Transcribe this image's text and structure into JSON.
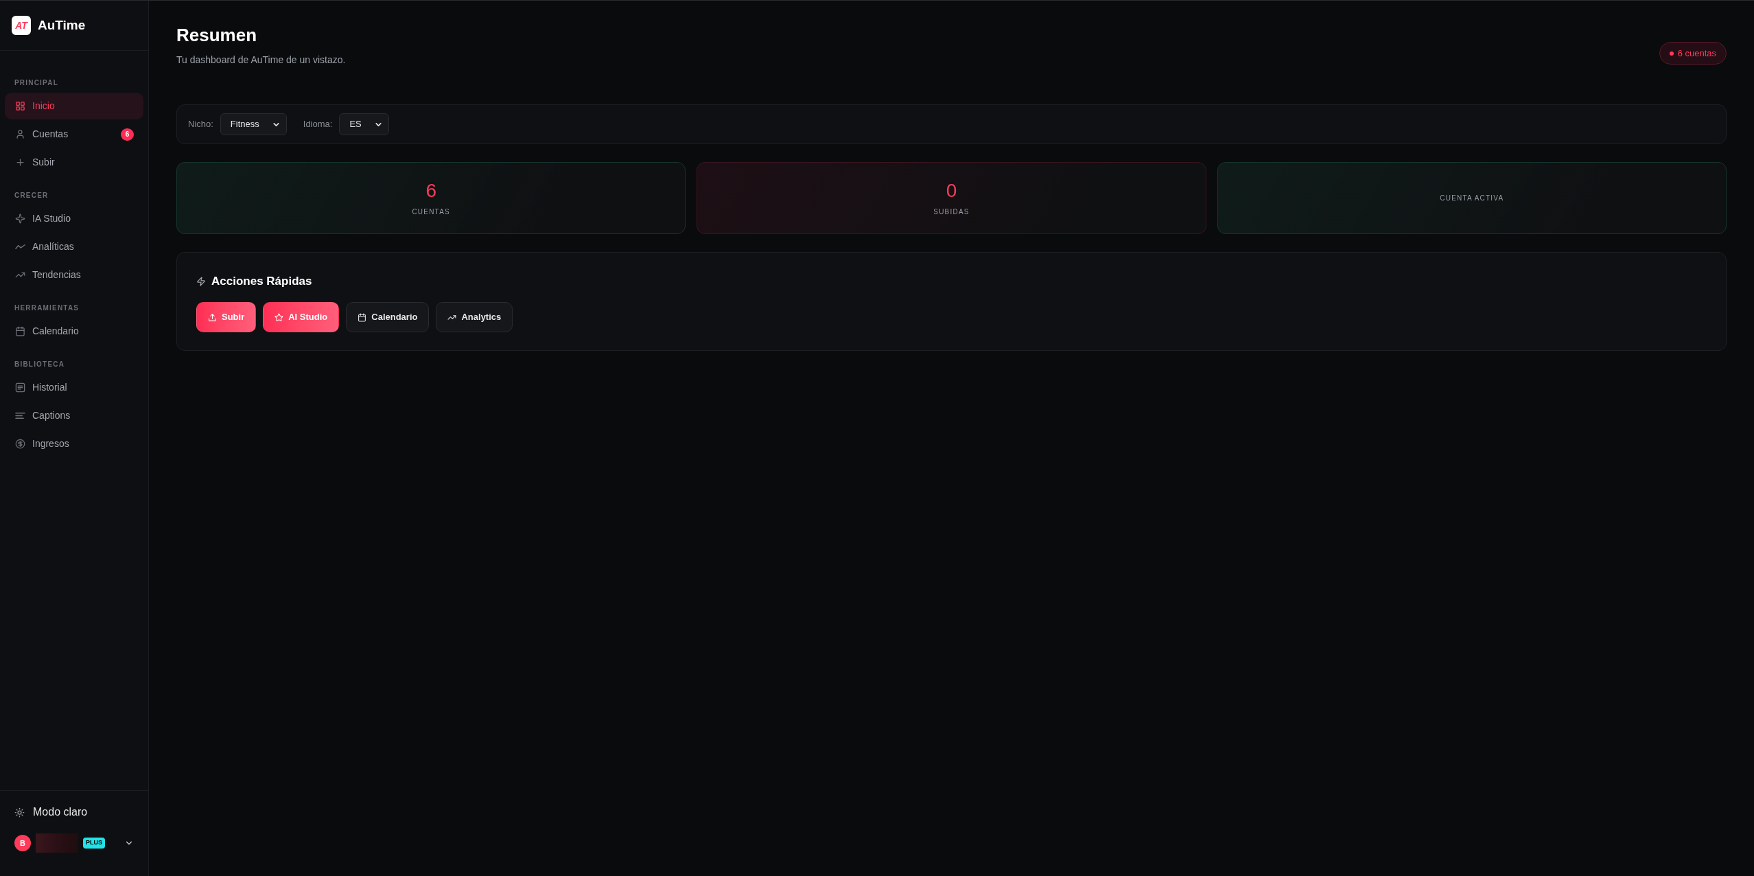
{
  "sidebar": {
    "logo": {
      "mark": "AT",
      "name": "AuTime"
    },
    "sections": [
      {
        "label": "PRINCIPAL",
        "items": [
          {
            "label": "Inicio",
            "selected": true
          },
          {
            "label": "Cuentas",
            "selected": false,
            "badge": "6"
          },
          {
            "label": "Subir",
            "selected": false
          }
        ]
      },
      {
        "label": "CRECER",
        "items": [
          {
            "label": "IA Studio",
            "selected": false
          },
          {
            "label": "Analíticas",
            "selected": false
          },
          {
            "label": "Tendencias",
            "selected": false
          }
        ]
      },
      {
        "label": "HERRAMIENTAS",
        "items": [
          {
            "label": "Calendario",
            "selected": false
          }
        ]
      },
      {
        "label": "BIBLIOTECA",
        "items": [
          {
            "label": "Historial",
            "selected": false
          },
          {
            "label": "Captions",
            "selected": false
          },
          {
            "label": "Ingresos",
            "selected": false
          }
        ]
      }
    ],
    "theme_toggle": {
      "label": "Modo claro"
    },
    "user": {
      "initial": "B",
      "plan": "PLUS"
    }
  },
  "header": {
    "title": "Resumen",
    "subtitle": "Tu dashboard de AuTime de un vistazo.",
    "badge": "6 cuentas"
  },
  "filters": [
    {
      "label": "Nicho:",
      "value": "Fitness"
    },
    {
      "label": "Idioma:",
      "value": "ES"
    }
  ],
  "stats": [
    {
      "value": "6",
      "label": "CUENTAS",
      "color": "#17352c"
    },
    {
      "value": "0",
      "label": "SUBIDAS",
      "color": "#3a1520"
    },
    {
      "label": "CUENTA ACTIVA",
      "color": "#17352c"
    }
  ],
  "quick_actions": {
    "title": "Acciones Rápidas",
    "buttons": [
      {
        "label": "Subir",
        "kind": "primary"
      },
      {
        "label": "AI Studio",
        "kind": "primary"
      },
      {
        "label": "Calendario",
        "kind": "secondary"
      },
      {
        "label": "Analytics",
        "kind": "secondary"
      }
    ]
  }
}
